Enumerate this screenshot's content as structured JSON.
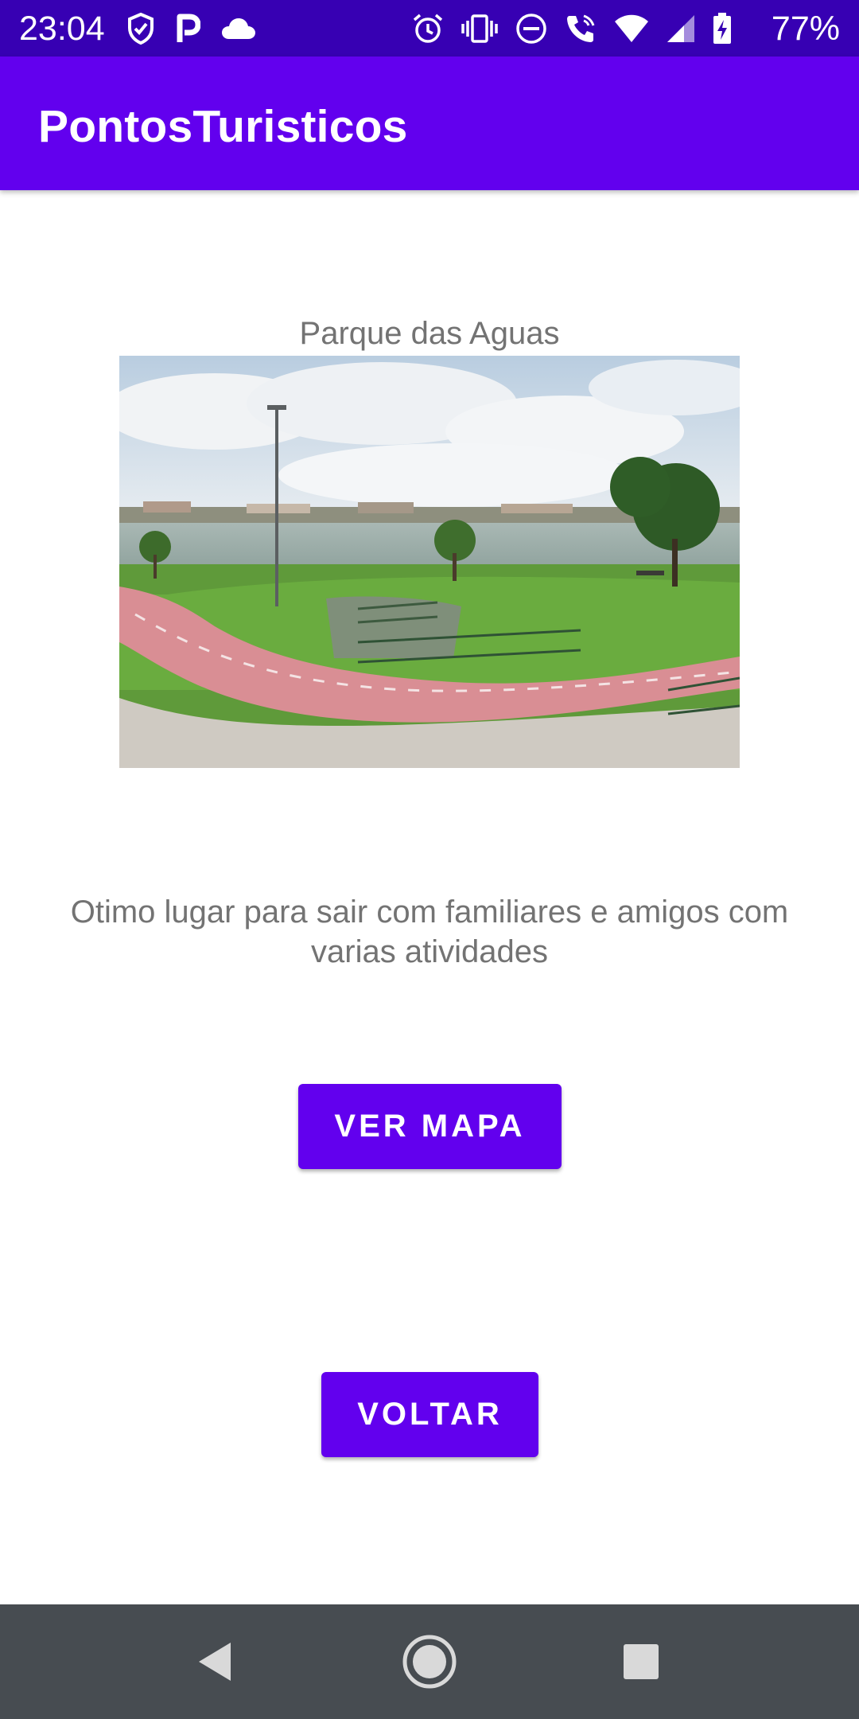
{
  "status_bar": {
    "time": "23:04",
    "battery_percent": "77%",
    "left_icons": [
      "shield-check-icon",
      "parking-p-icon",
      "cloud-icon"
    ],
    "right_icons": [
      "alarm-icon",
      "vibrate-icon",
      "do-not-disturb-icon",
      "wifi-calling-icon",
      "wifi-icon",
      "cell-signal-icon",
      "battery-charging-icon"
    ]
  },
  "app_bar": {
    "title": "PontosTuristicos"
  },
  "content": {
    "place_title": "Parque das Aguas",
    "description": "Otimo lugar para sair com familiares e amigos com varias atividades",
    "map_button_label": "VER MAPA",
    "back_button_label": "VOLTAR"
  },
  "nav_bar": {
    "buttons": [
      "back-triangle-icon",
      "home-circle-icon",
      "recents-square-icon"
    ]
  },
  "colors": {
    "status_bar": "#3700b3",
    "primary": "#6200ee",
    "text_secondary": "#737373",
    "nav_bar": "#474c51"
  }
}
